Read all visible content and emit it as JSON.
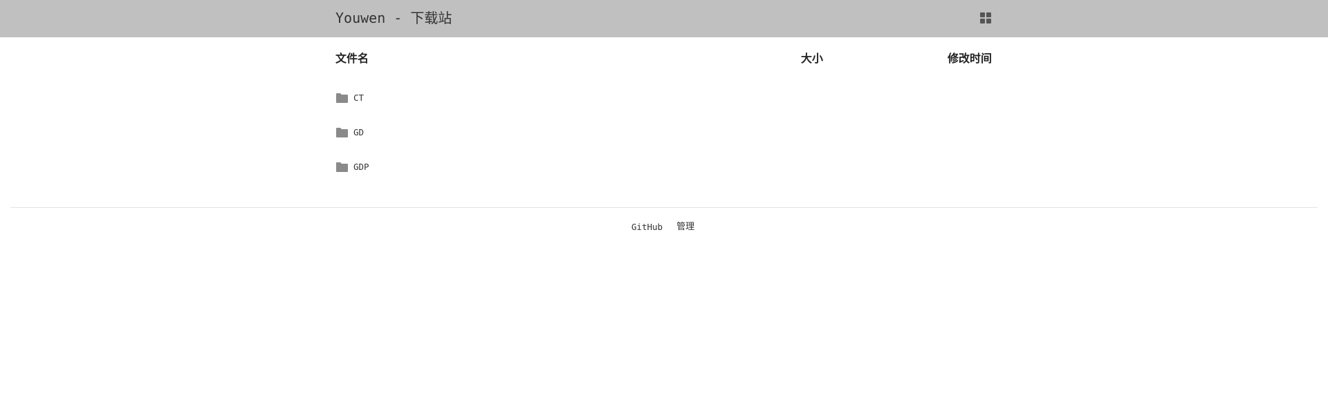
{
  "header": {
    "title": "Youwen - 下载站",
    "view_toggle_icon": "grid-icon"
  },
  "table": {
    "columns": [
      "文件名",
      "大小",
      "修改时间"
    ],
    "rows": [
      {
        "name": "CT",
        "icon": "folder-icon",
        "size": "",
        "modified": ""
      },
      {
        "name": "GD",
        "icon": "folder-icon",
        "size": "",
        "modified": ""
      },
      {
        "name": "GDP",
        "icon": "folder-icon",
        "size": "",
        "modified": ""
      }
    ]
  },
  "footer": {
    "links": [
      "GitHub",
      "管理"
    ]
  },
  "colors": {
    "header_bg": "#c0c0c0",
    "icon_gray": "#8a8a8a",
    "text": "#333333",
    "divider": "#e3e3e3"
  }
}
